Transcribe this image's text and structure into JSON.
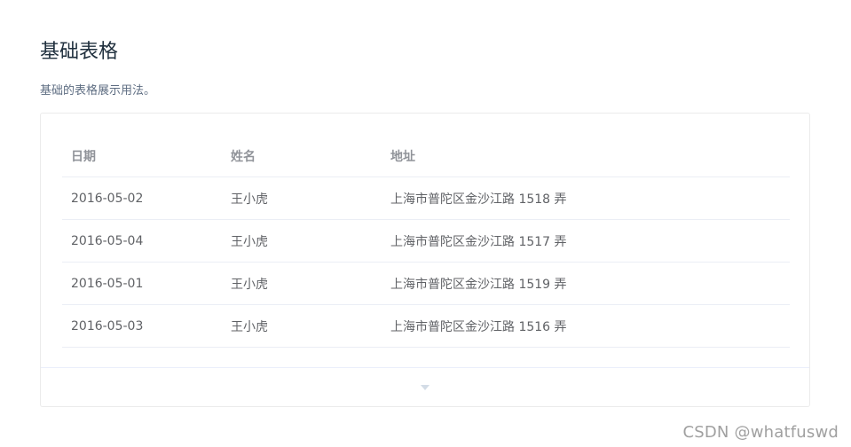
{
  "section": {
    "title": "基础表格",
    "description": "基础的表格展示用法。"
  },
  "table": {
    "columns": [
      "日期",
      "姓名",
      "地址"
    ],
    "rows": [
      {
        "date": "2016-05-02",
        "name": "王小虎",
        "address": "上海市普陀区金沙江路 1518 弄"
      },
      {
        "date": "2016-05-04",
        "name": "王小虎",
        "address": "上海市普陀区金沙江路 1517 弄"
      },
      {
        "date": "2016-05-01",
        "name": "王小虎",
        "address": "上海市普陀区金沙江路 1519 弄"
      },
      {
        "date": "2016-05-03",
        "name": "王小虎",
        "address": "上海市普陀区金沙江路 1516 弄"
      }
    ]
  },
  "demo_control": {
    "icon": "caret-down-icon"
  },
  "watermark": "CSDN @whatfuswd"
}
